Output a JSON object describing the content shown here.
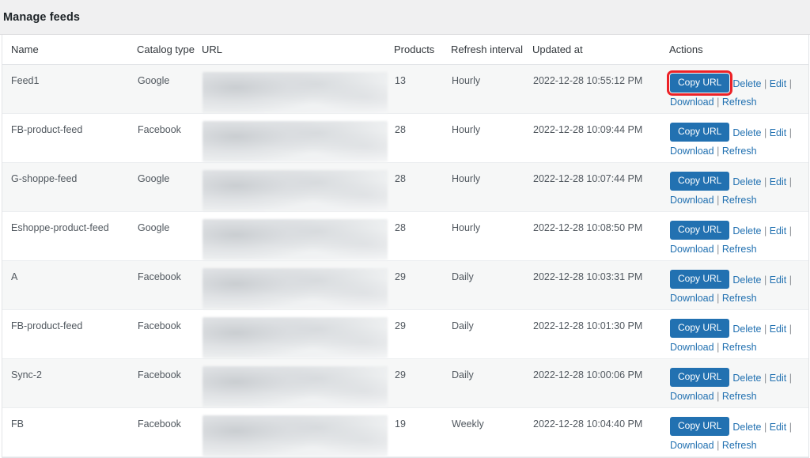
{
  "header": {
    "title": "Manage feeds",
    "background": "#f0f0f1"
  },
  "theme": {
    "button_blue": "#2271b1",
    "link_blue": "#2271b1",
    "highlight_red": "#ec2227",
    "row_alt": "#f6f7f7",
    "row_base": "#ffffff",
    "border": "#e2e4e7"
  },
  "table": {
    "columns": [
      {
        "key": "name",
        "label": "Name"
      },
      {
        "key": "catalog",
        "label": "Catalog type"
      },
      {
        "key": "url",
        "label": "URL"
      },
      {
        "key": "products",
        "label": "Products"
      },
      {
        "key": "refresh",
        "label": "Refresh interval"
      },
      {
        "key": "updated",
        "label": "Updated at"
      },
      {
        "key": "actions",
        "label": "Actions"
      }
    ],
    "actions": {
      "copy_url_label": "Copy URL",
      "delete_label": "Delete",
      "edit_label": "Edit",
      "download_label": "Download",
      "refresh_label": "Refresh",
      "separator": "|"
    },
    "url_cell_value": "",
    "rows": [
      {
        "name": "Feed1",
        "catalog": "Google",
        "products": "13",
        "refresh": "Hourly",
        "updated": "2022-12-28 10:55:12 PM",
        "highlighted": true
      },
      {
        "name": "FB-product-feed",
        "catalog": "Facebook",
        "products": "28",
        "refresh": "Hourly",
        "updated": "2022-12-28 10:09:44 PM",
        "highlighted": false
      },
      {
        "name": "G-shoppe-feed",
        "catalog": "Google",
        "products": "28",
        "refresh": "Hourly",
        "updated": "2022-12-28 10:07:44 PM",
        "highlighted": false
      },
      {
        "name": "Eshoppe-product-feed",
        "catalog": "Google",
        "products": "28",
        "refresh": "Hourly",
        "updated": "2022-12-28 10:08:50 PM",
        "highlighted": false
      },
      {
        "name": "A",
        "catalog": "Facebook",
        "products": "29",
        "refresh": "Daily",
        "updated": "2022-12-28 10:03:31 PM",
        "highlighted": false
      },
      {
        "name": "FB-product-feed",
        "catalog": "Facebook",
        "products": "29",
        "refresh": "Daily",
        "updated": "2022-12-28 10:01:30 PM",
        "highlighted": false
      },
      {
        "name": "Sync-2",
        "catalog": "Facebook",
        "products": "29",
        "refresh": "Daily",
        "updated": "2022-12-28 10:00:06 PM",
        "highlighted": false
      },
      {
        "name": "FB",
        "catalog": "Facebook",
        "products": "19",
        "refresh": "Weekly",
        "updated": "2022-12-28 10:04:40 PM",
        "highlighted": false
      }
    ]
  }
}
